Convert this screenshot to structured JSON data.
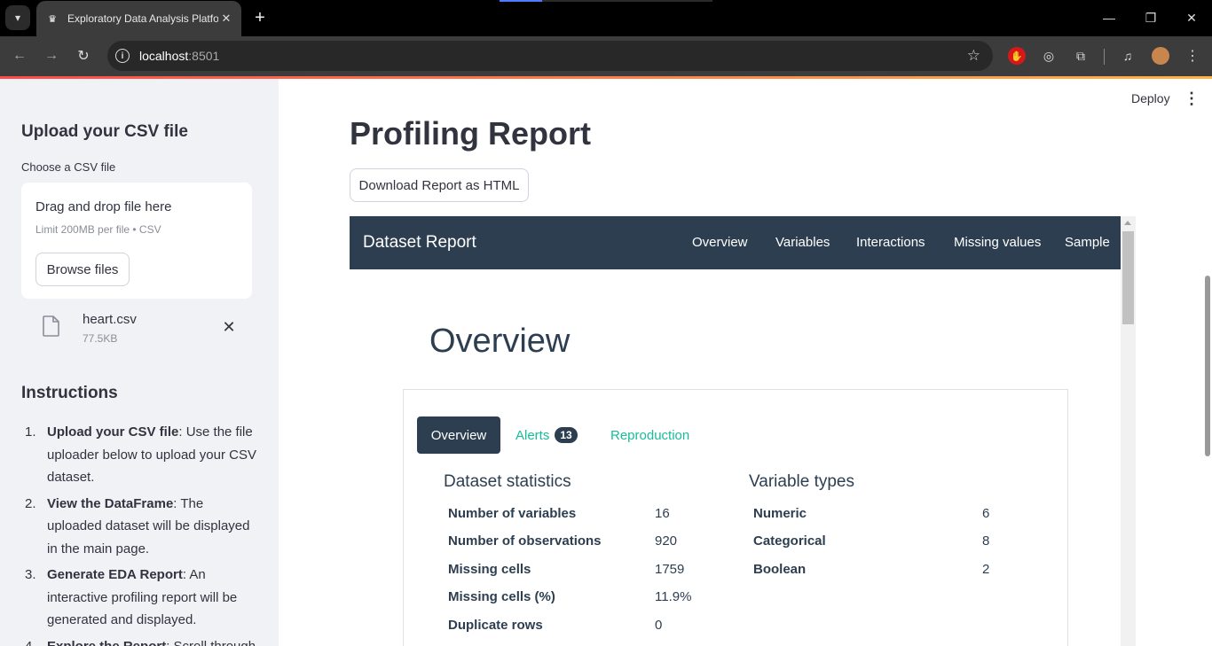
{
  "browser": {
    "tab_title": "Exploratory Data Analysis Platform",
    "url_host": "localhost",
    "url_port": ":8501"
  },
  "sidebar": {
    "upload_title": "Upload your CSV file",
    "choose_label": "Choose a CSV file",
    "dropzone_text": "Drag and drop file here",
    "dropzone_limit": "Limit 200MB per file • CSV",
    "browse_label": "Browse files",
    "file_name": "heart.csv",
    "file_size": "77.5KB",
    "instructions_title": "Instructions",
    "instructions": [
      {
        "num": "1.",
        "bold": "Upload your CSV file",
        "text": ": Use the file uploader below to upload your CSV dataset."
      },
      {
        "num": "2.",
        "bold": "View the DataFrame",
        "text": ": The uploaded dataset will be displayed in the main page."
      },
      {
        "num": "3.",
        "bold": "Generate EDA Report",
        "text": ": An interactive profiling report will be generated and displayed."
      },
      {
        "num": "4.",
        "bold": "Explore the Report",
        "text": ": Scroll through"
      }
    ]
  },
  "main": {
    "deploy_label": "Deploy",
    "page_title": "Profiling Report",
    "download_label": "Download Report as HTML"
  },
  "report": {
    "brand": "Dataset Report",
    "nav": [
      "Overview",
      "Variables",
      "Interactions",
      "Missing values",
      "Sample"
    ],
    "overview_heading": "Overview",
    "tabs": {
      "overview": "Overview",
      "alerts": "Alerts",
      "alerts_count": "13",
      "reproduction": "Reproduction"
    },
    "dataset_statistics": {
      "title": "Dataset statistics",
      "rows": [
        {
          "label": "Number of variables",
          "value": "16"
        },
        {
          "label": "Number of observations",
          "value": "920"
        },
        {
          "label": "Missing cells",
          "value": "1759"
        },
        {
          "label": "Missing cells (%)",
          "value": "11.9%"
        },
        {
          "label": "Duplicate rows",
          "value": "0"
        }
      ]
    },
    "variable_types": {
      "title": "Variable types",
      "rows": [
        {
          "label": "Numeric",
          "value": "6"
        },
        {
          "label": "Categorical",
          "value": "8"
        },
        {
          "label": "Boolean",
          "value": "2"
        }
      ]
    }
  },
  "colors": {
    "report_navy": "#2c3e50",
    "report_teal": "#18bc9c",
    "sidebar_bg": "#f0f2f6",
    "accent_red": "#ff4b4b"
  }
}
